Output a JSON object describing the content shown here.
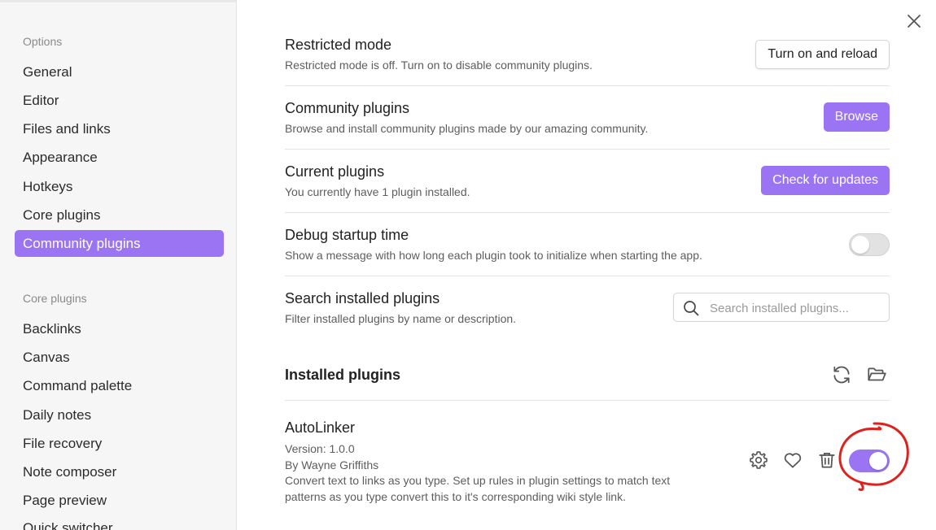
{
  "sidebar": {
    "options_heading": "Options",
    "options_items": [
      {
        "label": "General"
      },
      {
        "label": "Editor"
      },
      {
        "label": "Files and links"
      },
      {
        "label": "Appearance"
      },
      {
        "label": "Hotkeys"
      },
      {
        "label": "Core plugins"
      },
      {
        "label": "Community plugins",
        "active": true
      }
    ],
    "core_heading": "Core plugins",
    "core_items": [
      {
        "label": "Backlinks"
      },
      {
        "label": "Canvas"
      },
      {
        "label": "Command palette"
      },
      {
        "label": "Daily notes"
      },
      {
        "label": "File recovery"
      },
      {
        "label": "Note composer"
      },
      {
        "label": "Page preview"
      },
      {
        "label": "Quick switcher"
      }
    ]
  },
  "settings": {
    "restricted": {
      "name": "Restricted mode",
      "desc": "Restricted mode is off. Turn on to disable community plugins.",
      "button": "Turn on and reload"
    },
    "community": {
      "name": "Community plugins",
      "desc": "Browse and install community plugins made by our amazing community.",
      "button": "Browse"
    },
    "current": {
      "name": "Current plugins",
      "desc": "You currently have 1 plugin installed.",
      "button": "Check for updates"
    },
    "debug": {
      "name": "Debug startup time",
      "desc": "Show a message with how long each plugin took to initialize when starting the app.",
      "enabled": false
    },
    "search": {
      "name": "Search installed plugins",
      "desc": "Filter installed plugins by name or description.",
      "placeholder": "Search installed plugins..."
    }
  },
  "installed": {
    "heading": "Installed plugins",
    "plugins": [
      {
        "name": "AutoLinker",
        "version": "Version: 1.0.0",
        "author": "By Wayne Griffiths",
        "description": "Convert text to links as you type. Set up rules in plugin settings to match text patterns as you type convert this to it's corresponding wiki style link.",
        "enabled": true
      }
    ]
  },
  "colors": {
    "accent": "#9a74f2",
    "annotation": "#e0201c"
  }
}
